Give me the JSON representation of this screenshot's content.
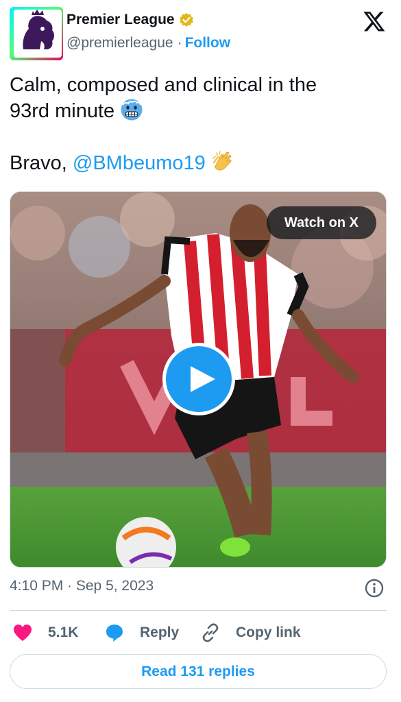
{
  "account": {
    "name": "Premier League",
    "handle": "@premierleague",
    "separator": "·",
    "follow_label": "Follow",
    "verified_icon": "gold-verified-badge",
    "avatar_icon": "premier-league-lion-logo"
  },
  "tweet": {
    "line1": "Calm, composed and clinical in the",
    "line2": "93rd minute",
    "line2_emoji": "cold-face-emoji",
    "line3_prefix": "Bravo, ",
    "mention": "@BMbeumo19",
    "line3_emoji": "clapping-hands-emoji"
  },
  "media": {
    "watch_label": "Watch on X",
    "play_icon": "play-icon"
  },
  "timestamp": "4:10 PM · Sep 5, 2023",
  "actions": {
    "likes": "5.1K",
    "reply_label": "Reply",
    "copy_label": "Copy link"
  },
  "read_replies_label": "Read 131 replies",
  "colors": {
    "accent": "#1d9bf0",
    "like": "#f91880",
    "secondary_text": "#536471",
    "border": "#cfd9de"
  }
}
